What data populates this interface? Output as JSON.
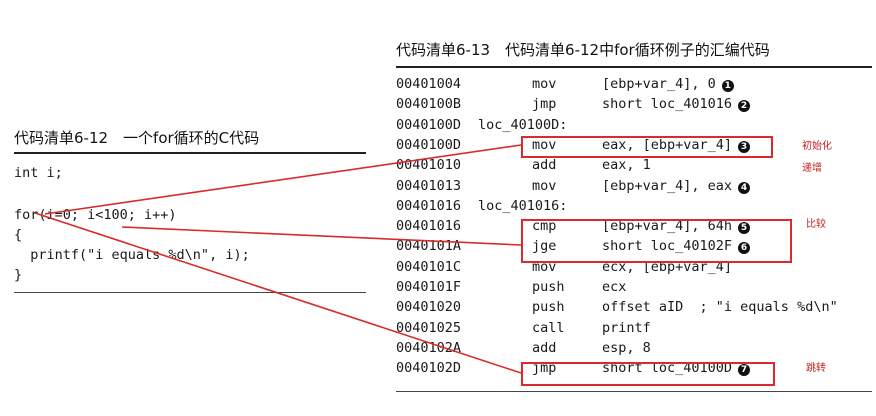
{
  "left_listing": {
    "title": "代码清单6-12　一个for循环的C代码",
    "lines": [
      "int i;",
      "",
      "for(i=0; i<100; i++)",
      "{",
      "  printf(\"i equals %d\\n\", i);",
      "}"
    ]
  },
  "right_listing": {
    "title": "代码清单6-13　代码清单6-12中for循环例子的汇编代码",
    "rows": [
      {
        "addr": "00401004",
        "label": "",
        "mnemonic": "mov",
        "operands": "[ebp+var_4], 0",
        "marker": "1"
      },
      {
        "addr": "0040100B",
        "label": "",
        "mnemonic": "jmp",
        "operands": "short loc_401016",
        "marker": "2"
      },
      {
        "addr": "0040100D",
        "label": "loc_40100D:",
        "mnemonic": "",
        "operands": "",
        "marker": ""
      },
      {
        "addr": "0040100D",
        "label": "",
        "mnemonic": "mov",
        "operands": "eax, [ebp+var_4]",
        "marker": "3"
      },
      {
        "addr": "00401010",
        "label": "",
        "mnemonic": "add",
        "operands": "eax, 1",
        "marker": ""
      },
      {
        "addr": "00401013",
        "label": "",
        "mnemonic": "mov",
        "operands": "[ebp+var_4], eax",
        "marker": "4"
      },
      {
        "addr": "00401016",
        "label": "loc_401016:",
        "mnemonic": "",
        "operands": "",
        "marker": ""
      },
      {
        "addr": "00401016",
        "label": "",
        "mnemonic": "cmp",
        "operands": "[ebp+var_4], 64h",
        "marker": "5"
      },
      {
        "addr": "0040101A",
        "label": "",
        "mnemonic": "jge",
        "operands": "short loc_40102F",
        "marker": "6"
      },
      {
        "addr": "0040101C",
        "label": "",
        "mnemonic": "mov",
        "operands": "ecx, [ebp+var_4]",
        "marker": ""
      },
      {
        "addr": "0040101F",
        "label": "",
        "mnemonic": "push",
        "operands": "ecx",
        "marker": ""
      },
      {
        "addr": "00401020",
        "label": "",
        "mnemonic": "push",
        "operands": "offset aID  ; \"i equals %d\\n\"",
        "marker": ""
      },
      {
        "addr": "00401025",
        "label": "",
        "mnemonic": "call",
        "operands": "printf",
        "marker": ""
      },
      {
        "addr": "0040102A",
        "label": "",
        "mnemonic": "add",
        "operands": "esp, 8",
        "marker": ""
      },
      {
        "addr": "0040102D",
        "label": "",
        "mnemonic": "jmp",
        "operands": "short loc_40100D",
        "marker": "7"
      }
    ]
  },
  "annotations": {
    "init": "初始化",
    "increment": "递增",
    "compare": "比较",
    "jump": "跳转"
  },
  "colors": {
    "annotation_red": "#d92b2b",
    "text": "#1a1a1a"
  }
}
